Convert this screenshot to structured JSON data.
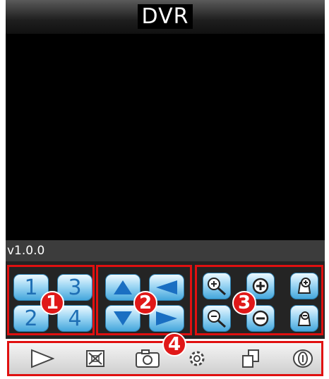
{
  "header": {
    "title": "DVR"
  },
  "status": {
    "version": "v1.0.0"
  },
  "channels": {
    "ch1": "1",
    "ch2": "2",
    "ch3": "3",
    "ch4": "4"
  },
  "markers": {
    "m1": "1",
    "m2": "2",
    "m3": "3",
    "m4": "4"
  },
  "icons": {
    "ptz": [
      "arrow-up-icon",
      "arrow-left-icon",
      "arrow-down-icon",
      "arrow-right-icon"
    ],
    "zoom": [
      "zoom-in-icon",
      "plus-icon",
      "focus-in-icon",
      "zoom-out-icon",
      "minus-icon",
      "focus-out-icon"
    ],
    "toolbar": [
      "play-icon",
      "stop-icon",
      "camera-icon",
      "gear-icon",
      "copy-icon",
      "info-icon"
    ]
  },
  "colors": {
    "accent": "#e01010",
    "button_blue": "#44a6dc",
    "channel_text": "#1f6fb5"
  }
}
